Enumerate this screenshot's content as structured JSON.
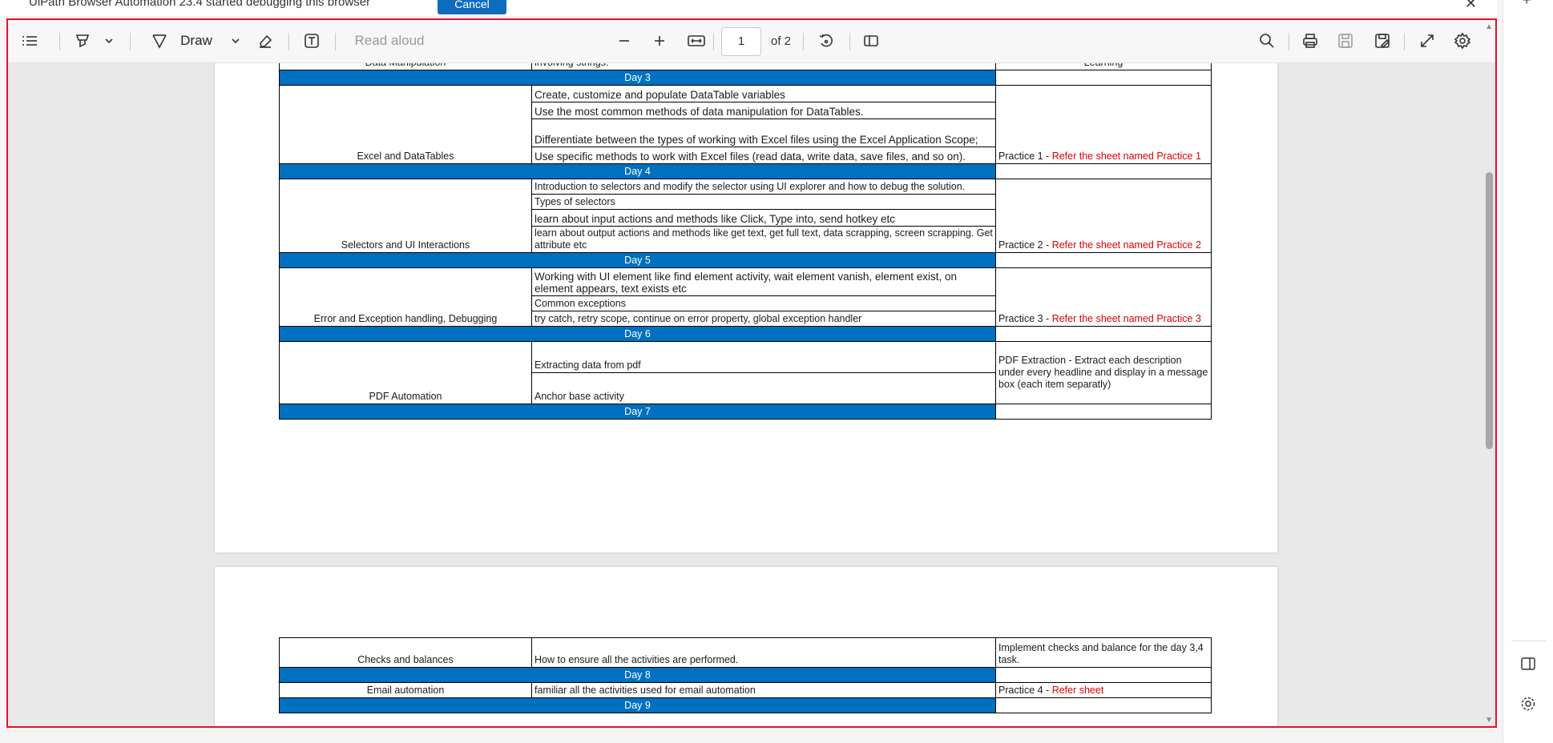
{
  "infobar": {
    "message": "UiPath Browser Automation 23.4 started debugging this browser",
    "cancel_label": "Cancel"
  },
  "toolbar": {
    "draw_label": "Draw",
    "read_aloud_label": "Read aloud",
    "page_number": "1",
    "page_of": "of 2"
  },
  "page1": {
    "top_row": {
      "topic": "Data Manipulation",
      "desc": "involving strings.",
      "prac": "Learning"
    },
    "days": {
      "d3": "Day 3",
      "d4": "Day 4",
      "d5": "Day 5",
      "d6": "Day 6",
      "d7": "Day 7"
    },
    "excel": {
      "topic": "Excel and DataTables",
      "items": [
        "Create, customize and populate DataTable variables",
        "Use the most common methods of data manipulation for DataTables.",
        "Differentiate between the types of working with Excel files using the Excel Application Scope;",
        "Use specific methods to work with Excel files (read data, write data, save files, and so on)."
      ],
      "prac_prefix": "Practice 1 - ",
      "prac_link": "Refer the sheet named Practice 1"
    },
    "selectors": {
      "topic": "Selectors and UI Interactions",
      "items": [
        "Introduction to selectors and modify the selector using UI explorer and how to debug the solution.",
        "Types of selectors",
        "learn about input actions and methods like Click, Type into, send hotkey etc",
        "learn about output actions and methods like get text, get full text, data scrapping, screen scrapping. Get attribute etc"
      ],
      "prac_prefix": "Practice 2 - ",
      "prac_link": "Refer the sheet named Practice 2"
    },
    "errors": {
      "topic": "Error and Exception handling, Debugging",
      "items": [
        "Working with UI element like find element activity, wait element vanish, element exist, on element appears, text exists etc",
        "Common exceptions",
        "try catch, retry scope, continue on error property, global exception handler"
      ],
      "prac_prefix": "Practice 3 - ",
      "prac_link": "Refer the sheet named Practice 3"
    },
    "pdf": {
      "topic": "PDF Automation",
      "items": [
        "Extracting data from pdf",
        "Anchor base activity"
      ],
      "prac": "PDF Extraction - Extract each description under every headline and display in a message box (each item separatly)"
    }
  },
  "page2": {
    "checks": {
      "topic": "Checks and balances",
      "desc": "How to ensure all the activities are performed.",
      "prac": "Implement checks and balance for the day 3,4 task."
    },
    "d8": "Day 8",
    "email": {
      "topic": "Email automation",
      "desc": "familiar all the activities used for email automation",
      "prac_prefix": "Practice 4 - ",
      "prac_link": "Refer sheet"
    },
    "d9": "Day 9"
  },
  "colors": {
    "day_band": "#0070c0",
    "link_red": "#e00000",
    "frame_red": "#e81123"
  }
}
